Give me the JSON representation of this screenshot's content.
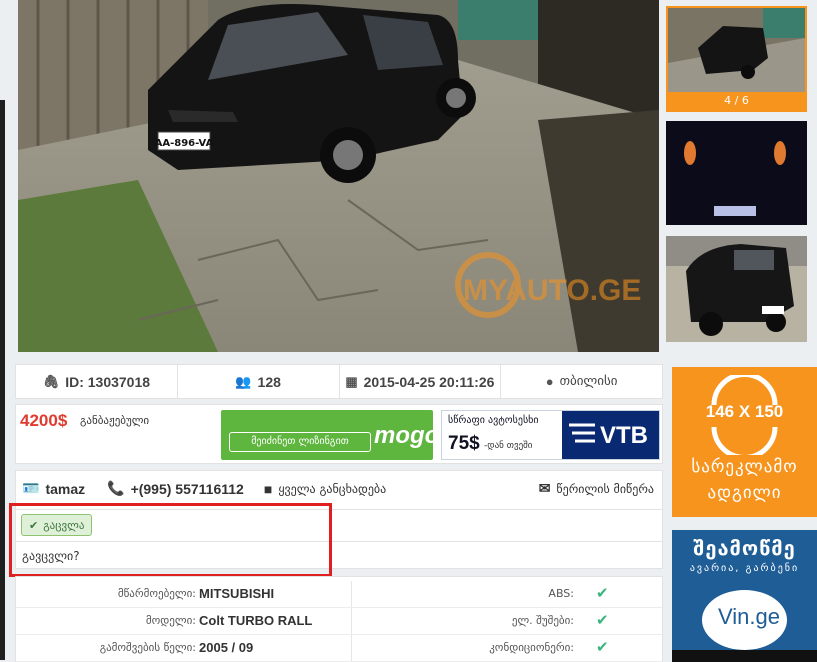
{
  "gallery": {
    "watermark": "MYAUTO.GE",
    "plate": "AA-896-VA",
    "counter": "4 / 6"
  },
  "info": {
    "id": "ID: 13037018",
    "views": "128",
    "date": "2015-04-25 20:11:26",
    "location": "თბილისი"
  },
  "price": {
    "value": "4200$",
    "note": "განბაჟებული"
  },
  "ads": {
    "mogo_button": "მეიძინეთ ლიზინგით",
    "mogo_logo": "mogo",
    "vtb_title": "სწრაფი ავტოსესხი",
    "vtb_amount": "75$",
    "vtb_suffix": "-დან თვეში",
    "vtb_logo": "VTB",
    "side_size": "146 X 150",
    "side_line1": "სარეკლამო",
    "side_line2": "ადგილი",
    "blue_title": "შეამოწმე",
    "blue_sub": "ავარია, გარბენი",
    "blue_logo": "Vin.ge"
  },
  "contact": {
    "name": "tamaz",
    "phone": "+(995) 557116112",
    "all_ads": "ყველა განცხადება",
    "message": "წერილის მიწერა",
    "swap_label": "გაცვლა",
    "swap_question": "გავცვლი?"
  },
  "specs": [
    {
      "label": "მწარმოებელი:",
      "value": "MITSUBISHI",
      "right_label": "ABS:"
    },
    {
      "label": "მოდელი:",
      "value": "Colt TURBO RALL",
      "right_label": "ელ. შუშები:"
    },
    {
      "label": "გამოშვების წელი:",
      "value": "2005 / 09",
      "right_label": "კონდიციონერი:"
    }
  ]
}
